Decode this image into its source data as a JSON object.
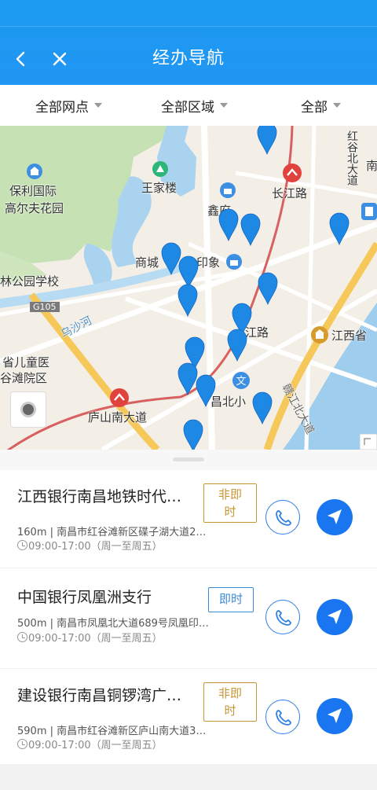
{
  "header": {
    "title": "经办导航",
    "back_icon": "back-chevron-icon",
    "close_icon": "close-icon",
    "background": "#1e98f0"
  },
  "filters": [
    {
      "label": "全部网点"
    },
    {
      "label": "全部区域"
    },
    {
      "label": "全部"
    }
  ],
  "map": {
    "labels": {
      "baoli": "保利国际",
      "gaoerfu": "高尔夫花园",
      "wangjialou": "王家楼",
      "xinfu": "鑫府",
      "changjianglu": "长江路",
      "hongu": "红谷北大道",
      "shangcheng": "商城",
      "yinxiang": "印象",
      "school": "林公园学校",
      "g105": "G105",
      "wushahe": "乌沙河",
      "jiangxisheng": "江西省",
      "jiangluRoad": "江路",
      "ertong": "省儿童医",
      "gutan": "谷滩院区",
      "changbei": "昌北小",
      "lushan": "庐山南大道",
      "ganjiang": "赣江北大道",
      "nan": "南"
    },
    "accent_pin": "#1e88e5"
  },
  "branches": [
    {
      "name": "江西银行南昌地铁时代…",
      "type": "非即时",
      "type_line1": "非即",
      "type_line2": "时",
      "meta": "160m | 南昌市红谷滩新区碟子湖大道2…",
      "hours": "09:00-17:00（周一至周五）"
    },
    {
      "name": "中国银行凤凰洲支行",
      "type": "即时",
      "meta": "500m | 南昌市凤凰北大道689号凤凰印…",
      "hours": "09:00-17:00（周一至周五）"
    },
    {
      "name": "建设银行南昌铜锣湾广…",
      "type": "非即时",
      "type_line1": "非即",
      "type_line2": "时",
      "meta": "590m | 南昌市红谷滩新区庐山南大道3…",
      "hours": "09:00-17:00（周一至周五）"
    }
  ]
}
